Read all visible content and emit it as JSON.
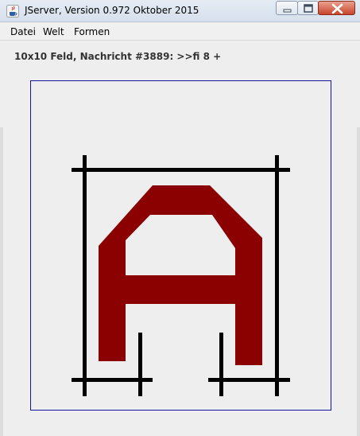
{
  "window": {
    "title": "JServer, Version 0.972 Oktober 2015"
  },
  "menu": {
    "items": [
      "Datei",
      "Welt",
      "Formen"
    ]
  },
  "status": {
    "text": "10x10 Feld, Nachricht #3889: >>fi 8 +"
  },
  "colors": {
    "letter_fill": "#8b0000",
    "frame_lines": "#000000",
    "canvas_border": "#1414a0"
  },
  "icons": {
    "app": "java-cup-icon",
    "minimize": "minimize-icon",
    "maximize": "maximize-icon",
    "close": "close-icon"
  }
}
